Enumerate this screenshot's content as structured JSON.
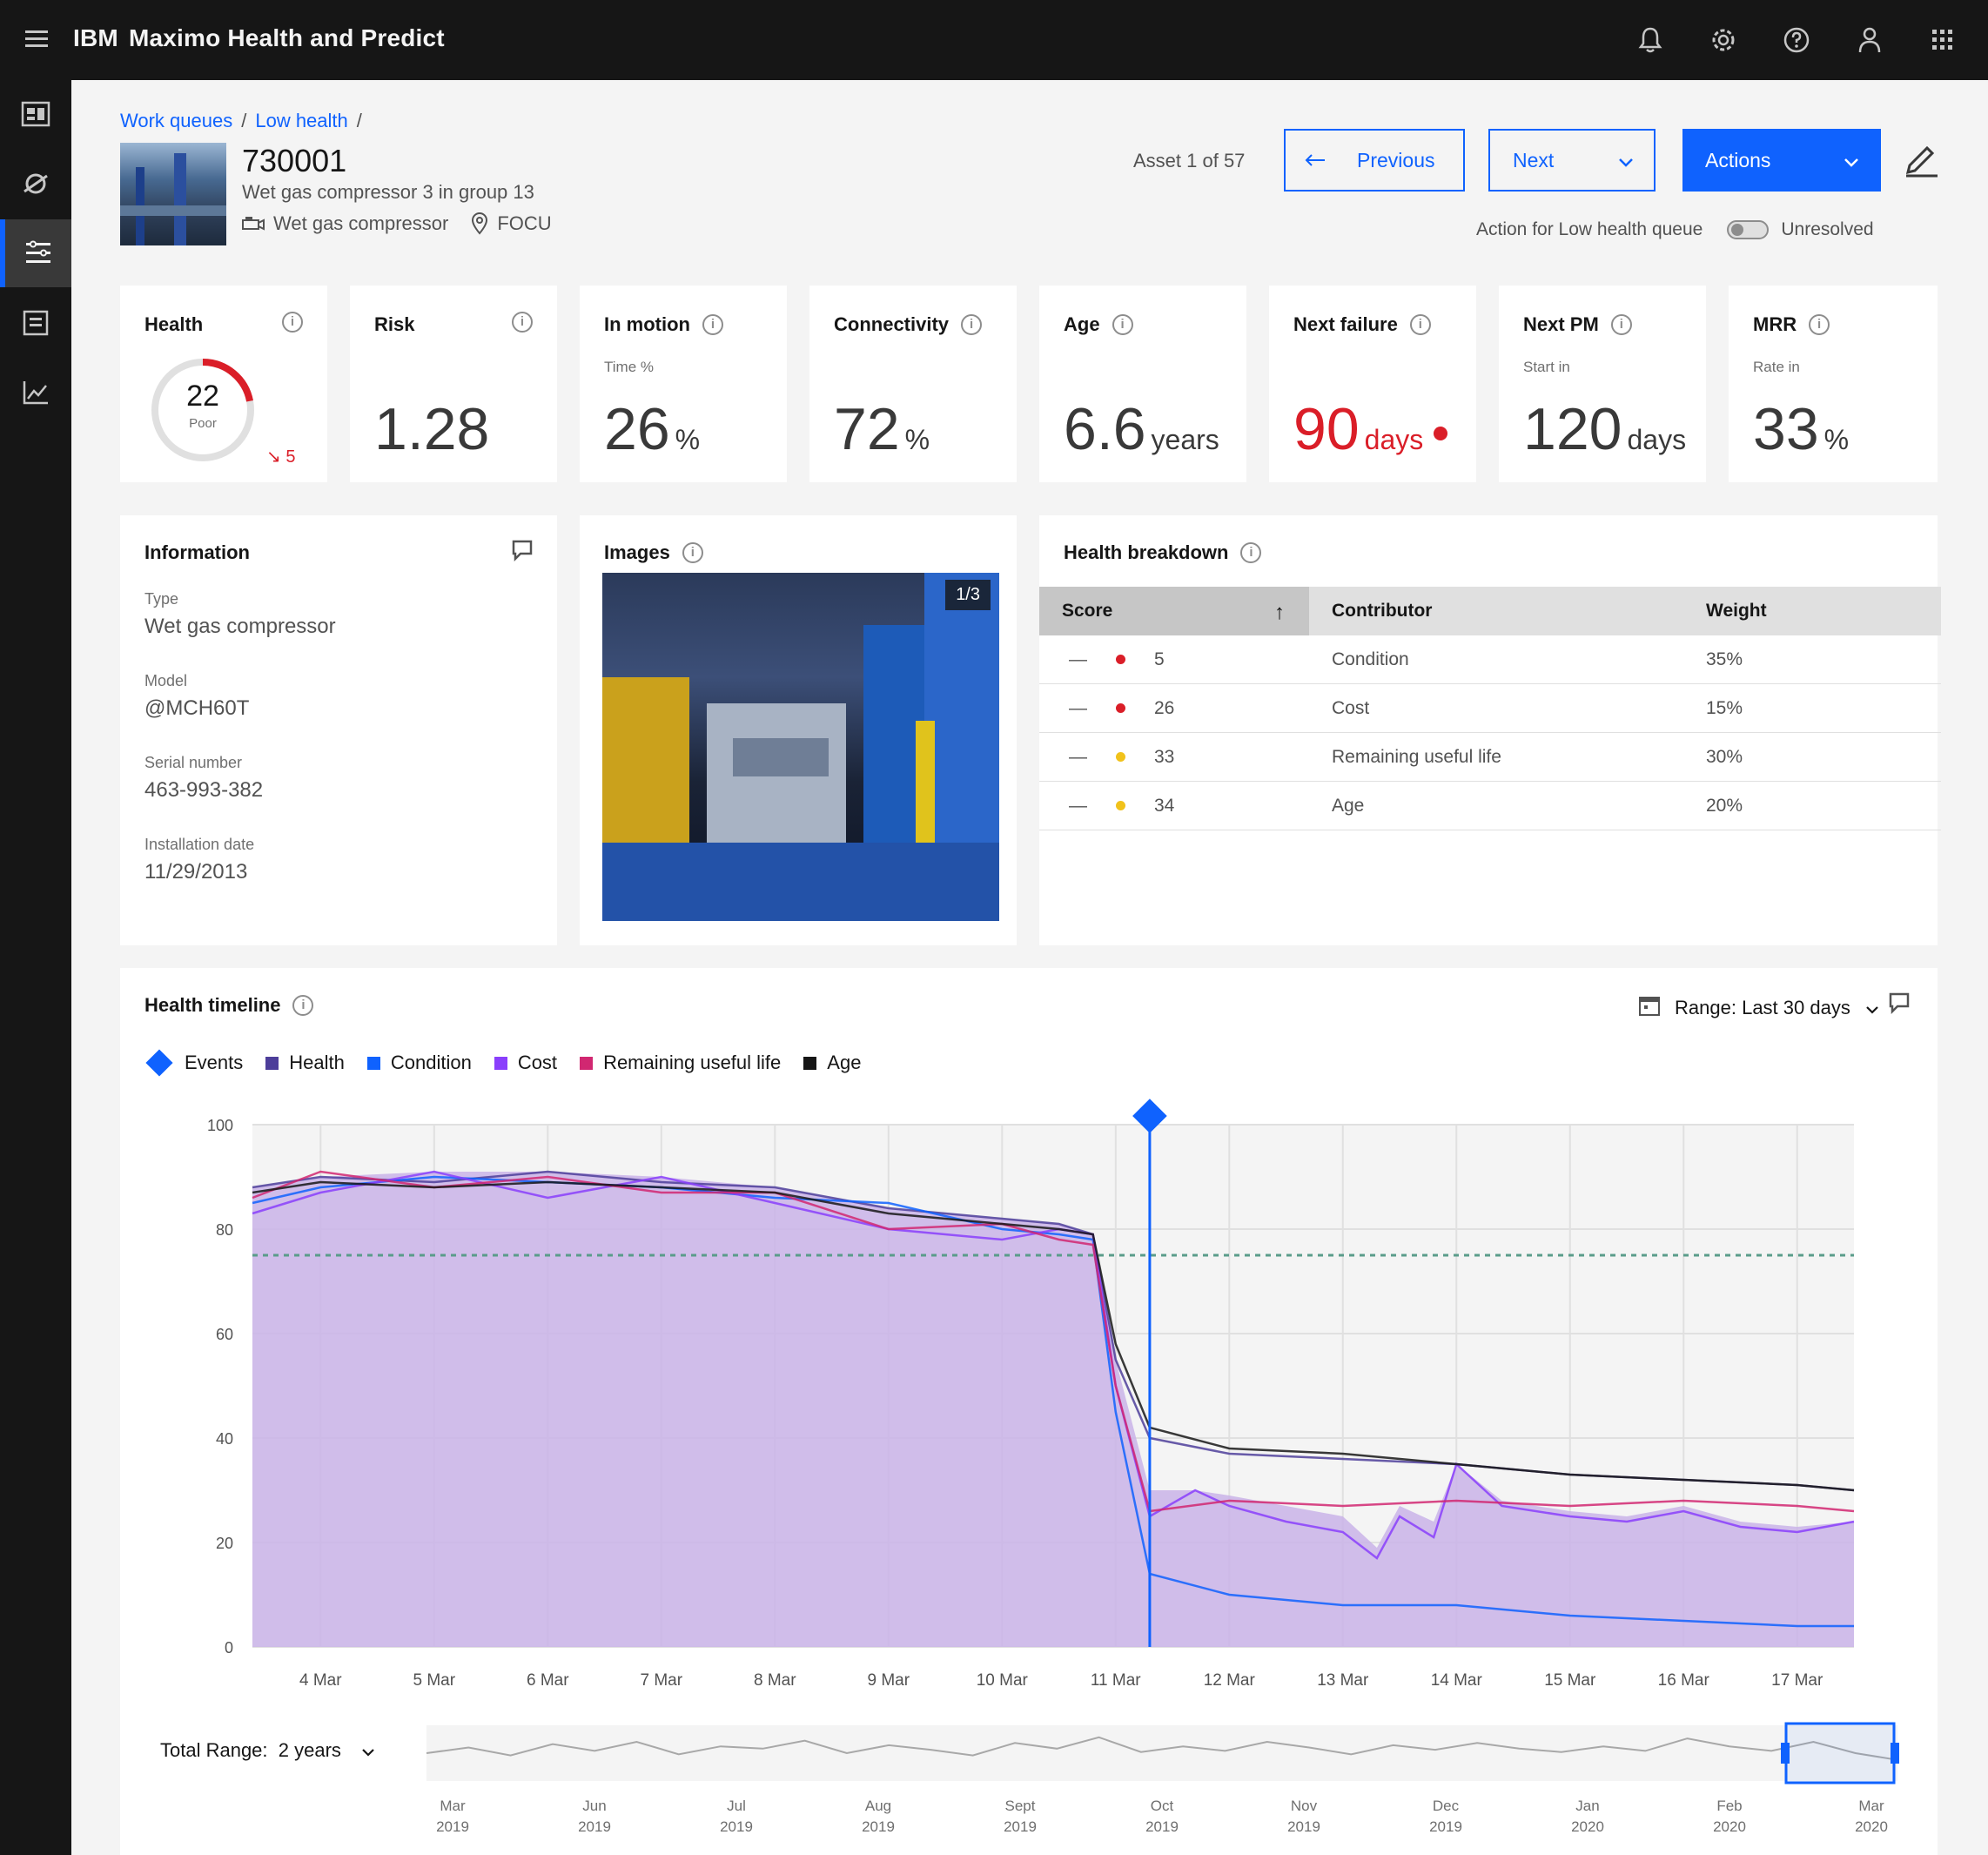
{
  "app": {
    "brand": "IBM",
    "title": "Maximo Health and Predict"
  },
  "header_icons": [
    "notification-icon",
    "settings-icon",
    "help-icon",
    "user-icon",
    "app-switcher-icon"
  ],
  "side_nav": [
    "dashboard-icon",
    "assets-icon",
    "work-queues-icon",
    "reports-icon",
    "analytics-icon"
  ],
  "breadcrumb": [
    {
      "label": "Work queues"
    },
    {
      "label": "Low health"
    }
  ],
  "asset": {
    "id": "730001",
    "description": "Wet gas compressor 3 in group 13",
    "type": "Wet gas compressor",
    "location": "FOCU"
  },
  "navigation": {
    "asset_count": "Asset 1 of 57",
    "previous_label": "Previous",
    "next_label": "Next",
    "actions_label": "Actions",
    "queue_action_label": "Action for Low health queue",
    "toggle_label": "Unresolved",
    "toggle_on": false
  },
  "kpis": {
    "health": {
      "title": "Health",
      "score": "22",
      "score_label": "Poor",
      "trend": "5",
      "score_fraction": 0.22
    },
    "risk": {
      "title": "Risk",
      "value": "1.28"
    },
    "in_motion": {
      "title": "In motion",
      "sub": "Time %",
      "value": "26",
      "unit": "%"
    },
    "connectivity": {
      "title": "Connectivity",
      "value": "72",
      "unit": "%"
    },
    "age": {
      "title": "Age",
      "value": "6.6",
      "unit": "years"
    },
    "next_failure": {
      "title": "Next failure",
      "value": "90",
      "unit": "days",
      "status_color": "#da1e28"
    },
    "next_pm": {
      "title": "Next PM",
      "sub": "Start in",
      "value": "120",
      "unit": "days"
    },
    "mrr": {
      "title": "MRR",
      "sub": "Rate in",
      "value": "33",
      "unit": "%"
    }
  },
  "information": {
    "title": "Information",
    "fields": [
      {
        "label": "Type",
        "value": "Wet gas compressor"
      },
      {
        "label": "Model",
        "value": "@MCH60T"
      },
      {
        "label": "Serial number",
        "value": "463-993-382"
      },
      {
        "label": "Installation date",
        "value": "11/29/2013"
      }
    ]
  },
  "images": {
    "title": "Images",
    "count": "1/3"
  },
  "health_breakdown": {
    "title": "Health breakdown",
    "columns": [
      "Score",
      "Contributor",
      "Weight"
    ],
    "rows": [
      {
        "score": "5",
        "contributor": "Condition",
        "weight": "35%",
        "color": "#da1e28"
      },
      {
        "score": "26",
        "contributor": "Cost",
        "weight": "15%",
        "color": "#da1e28"
      },
      {
        "score": "33",
        "contributor": "Remaining useful life",
        "weight": "30%",
        "color": "#f1c21b"
      },
      {
        "score": "34",
        "contributor": "Age",
        "weight": "20%",
        "color": "#f1c21b"
      }
    ]
  },
  "health_timeline": {
    "title": "Health timeline",
    "range_label": "Range:",
    "range_value": "Last 30 days",
    "total_range_label": "Total Range:",
    "total_range_value": "2 years",
    "legend": [
      {
        "name": "Events",
        "color": "#0f62fe",
        "shape": "diamond"
      },
      {
        "name": "Health",
        "color": "#4d3e9a",
        "shape": "square"
      },
      {
        "name": "Condition",
        "color": "#0f62fe",
        "shape": "square"
      },
      {
        "name": "Cost",
        "color": "#8a3ffc",
        "shape": "square"
      },
      {
        "name": "Remaining useful life",
        "color": "#d12771",
        "shape": "square"
      },
      {
        "name": "Age",
        "color": "#161616",
        "shape": "square"
      }
    ],
    "overview_ticks": [
      {
        "month": "Mar",
        "year": "2019"
      },
      {
        "month": "Jun",
        "year": "2019"
      },
      {
        "month": "Jul",
        "year": "2019"
      },
      {
        "month": "Aug",
        "year": "2019"
      },
      {
        "month": "Sept",
        "year": "2019"
      },
      {
        "month": "Oct",
        "year": "2019"
      },
      {
        "month": "Nov",
        "year": "2019"
      },
      {
        "month": "Dec",
        "year": "2019"
      },
      {
        "month": "Jan",
        "year": "2020"
      },
      {
        "month": "Feb",
        "year": "2020"
      },
      {
        "month": "Mar",
        "year": "2020"
      }
    ]
  },
  "chart_data": {
    "type": "area",
    "ylim": [
      0,
      100
    ],
    "y_ticks": [
      "100",
      "80",
      "60",
      "40",
      "20",
      "0"
    ],
    "categories": [
      "4 Mar",
      "5 Mar",
      "6 Mar",
      "7 Mar",
      "8 Mar",
      "9 Mar",
      "10 Mar",
      "11 Mar",
      "12 Mar",
      "13 Mar",
      "14 Mar",
      "15 Mar",
      "16 Mar",
      "17 Mar"
    ],
    "x_range": [
      3.4,
      17.5
    ],
    "threshold": 75,
    "event_x": 11.3,
    "series": [
      {
        "name": "Health",
        "color": "#4d3e9a",
        "x": [
          3.4,
          4,
          5,
          6,
          7,
          8,
          9,
          10,
          10.5,
          10.8,
          11,
          11.3,
          12,
          13,
          14,
          15,
          16,
          17,
          17.5
        ],
        "values": [
          88,
          90,
          89,
          91,
          89,
          88,
          84,
          82,
          81,
          79,
          55,
          40,
          37,
          36,
          35,
          33,
          32,
          31,
          30
        ]
      },
      {
        "name": "Condition",
        "color": "#0f62fe",
        "x": [
          3.4,
          4,
          5,
          6,
          7,
          8,
          9,
          10,
          10.5,
          10.8,
          11,
          11.3,
          12,
          13,
          14,
          15,
          16,
          17,
          17.5
        ],
        "values": [
          85,
          88,
          90,
          89,
          88,
          86,
          85,
          80,
          79,
          78,
          45,
          14,
          10,
          8,
          8,
          6,
          5,
          4,
          4
        ]
      },
      {
        "name": "Cost",
        "color": "#8a3ffc",
        "x": [
          3.4,
          4,
          5,
          6,
          7,
          8,
          9,
          10,
          10.5,
          10.8,
          11,
          11.3,
          11.7,
          12,
          12.5,
          13,
          13.3,
          13.5,
          13.8,
          14,
          14.4,
          15,
          15.5,
          16,
          16.5,
          17,
          17.5
        ],
        "values": [
          83,
          87,
          91,
          86,
          90,
          85,
          80,
          78,
          80,
          79,
          50,
          25,
          30,
          27,
          24,
          22,
          17,
          25,
          21,
          35,
          27,
          25,
          24,
          26,
          23,
          22,
          24
        ]
      },
      {
        "name": "Remaining useful life",
        "color": "#d12771",
        "x": [
          3.4,
          4,
          5,
          6,
          7,
          8,
          9,
          10,
          10.5,
          10.8,
          11,
          11.3,
          12,
          13,
          14,
          15,
          16,
          17,
          17.5
        ],
        "values": [
          86,
          91,
          88,
          90,
          87,
          87,
          80,
          81,
          78,
          77,
          50,
          26,
          28,
          27,
          28,
          27,
          28,
          27,
          26
        ]
      },
      {
        "name": "Age",
        "color": "#161616",
        "x": [
          3.4,
          4,
          5,
          6,
          7,
          8,
          9,
          10,
          10.5,
          10.8,
          11,
          11.3,
          12,
          13,
          14,
          15,
          16,
          17,
          17.5
        ],
        "values": [
          87,
          89,
          88,
          89,
          88,
          87,
          83,
          81,
          80,
          79,
          58,
          42,
          38,
          37,
          35,
          33,
          32,
          31,
          30
        ]
      }
    ],
    "area": {
      "x": [
        3.4,
        4,
        5,
        6,
        7,
        8,
        9,
        10,
        10.5,
        10.8,
        11,
        11.3,
        11.7,
        12,
        12.5,
        13,
        13.3,
        13.5,
        13.8,
        14,
        14.4,
        15,
        15.5,
        16,
        16.5,
        17,
        17.5
      ],
      "values": [
        88,
        90,
        91,
        91,
        90,
        88,
        84,
        82,
        81,
        79,
        55,
        30,
        30,
        29,
        27,
        25,
        19,
        27,
        24,
        35,
        28,
        26,
        25,
        27,
        24,
        23,
        24
      ],
      "color": "#c9b3e8"
    },
    "overview": [
      20,
      25,
      18,
      28,
      22,
      30,
      19,
      26,
      24,
      31,
      20,
      27,
      23,
      18,
      29,
      24,
      34,
      21,
      26,
      22,
      30,
      25,
      19,
      27,
      23,
      29,
      24,
      21,
      26,
      22,
      33,
      26,
      22,
      30,
      20,
      14
    ]
  }
}
